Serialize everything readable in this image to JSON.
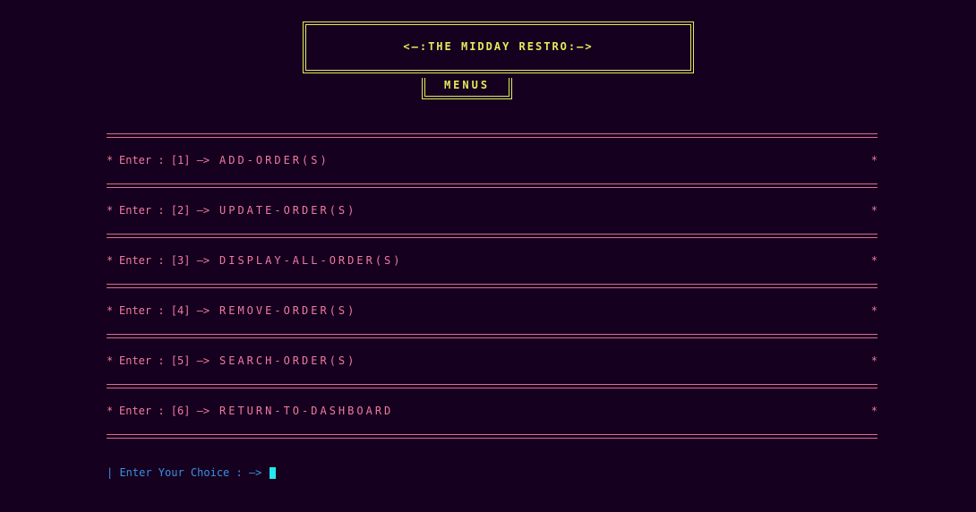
{
  "header": {
    "title": "<—:THE MIDDAY RESTRO:—>",
    "subtitle": "MENUS"
  },
  "menu": {
    "bullet": "*",
    "items": [
      {
        "prefix": "Enter : [1] —>",
        "label": "ADD-ORDER(S)"
      },
      {
        "prefix": "Enter : [2] —>",
        "label": "UPDATE-ORDER(S)"
      },
      {
        "prefix": "Enter : [3] —>",
        "label": "DISPLAY-ALL-ORDER(S)"
      },
      {
        "prefix": "Enter : [4] —>",
        "label": "REMOVE-ORDER(S)"
      },
      {
        "prefix": "Enter : [5] —>",
        "label": "SEARCH-ORDER(S)"
      },
      {
        "prefix": "Enter : [6] —>",
        "label": "RETURN-TO-DASHBOARD"
      }
    ]
  },
  "prompt": {
    "text": "| Enter Your Choice : —>"
  },
  "colors": {
    "background": "#15001f",
    "title": "#e8e85a",
    "menu_text": "#f07aa0",
    "separator": "#e06a8f",
    "prompt": "#3d8fe0",
    "cursor": "#26e6f0"
  }
}
